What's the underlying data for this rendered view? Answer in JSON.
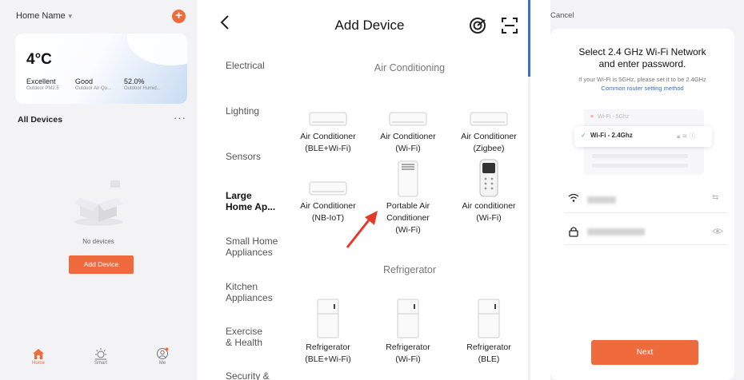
{
  "home": {
    "home_name": "Home Name",
    "weather": {
      "temperature": "4°C",
      "stats": [
        {
          "value": "Excellent",
          "label": "Outdoor PM2.5"
        },
        {
          "value": "Good",
          "label": "Outdoor Air Qu..."
        },
        {
          "value": "52.0%",
          "label": "Outdoor Humid..."
        }
      ]
    },
    "all_devices": "All Devices",
    "more": "···",
    "no_devices": "No devices",
    "add_device_button": "Add Device",
    "tabs": [
      {
        "label": "Home",
        "icon": "home-icon",
        "active": true
      },
      {
        "label": "Smart",
        "icon": "sun-icon",
        "active": false
      },
      {
        "label": "Me",
        "icon": "user-icon",
        "active": false
      }
    ],
    "accent": "#ef6a3c"
  },
  "add_device": {
    "title": "Add Device",
    "categories": [
      {
        "label": "Electrical",
        "active": false
      },
      {
        "label": "Lighting",
        "active": false
      },
      {
        "label": "Sensors",
        "active": false
      },
      {
        "label": "Large\nHome Ap...",
        "active": true
      },
      {
        "label": "Small Home\nAppliances",
        "active": false
      },
      {
        "label": "Kitchen\nAppliances",
        "active": false
      },
      {
        "label": "Exercise\n& Health",
        "active": false
      },
      {
        "label": "Security &",
        "active": false
      }
    ],
    "sections": [
      {
        "title": "Air Conditioning",
        "devices": [
          {
            "name": "Air Conditioner\n(BLE+Wi-Fi)",
            "icon": "ac-icon"
          },
          {
            "name": "Air Conditioner\n(Wi-Fi)",
            "icon": "ac-icon"
          },
          {
            "name": "Air Conditioner\n(Zigbee)",
            "icon": "ac-icon"
          },
          {
            "name": "Air Conditioner\n(NB-IoT)",
            "icon": "ac-icon"
          },
          {
            "name": "Portable Air\nConditioner\n(Wi-Fi)",
            "icon": "portable-ac-icon"
          },
          {
            "name": "Air conditioner\n(Wi-Fi)",
            "icon": "remote-icon"
          }
        ]
      },
      {
        "title": "Refrigerator",
        "devices": [
          {
            "name": "Refrigerator\n(BLE+Wi-Fi)",
            "icon": "fridge-icon"
          },
          {
            "name": "Refrigerator\n(Wi-Fi)",
            "icon": "fridge-icon"
          },
          {
            "name": "Refrigerator\n(BLE)",
            "icon": "fridge-icon"
          }
        ]
      }
    ],
    "annotation_color": "#e23b2a"
  },
  "wifi": {
    "cancel": "Cancel",
    "heading": "Select 2.4 GHz Wi-Fi Network\nand enter password.",
    "tip": "If your Wi-Fi is 5GHz, please set it to be 2.4GHz",
    "tip_link": "Common router setting method",
    "networks": [
      {
        "label": "Wi-Fi - 5Ghz",
        "status": "×"
      },
      {
        "label": "Wi-Fi - 2.4Ghz",
        "status": "✓"
      }
    ],
    "next_button": "Next"
  }
}
